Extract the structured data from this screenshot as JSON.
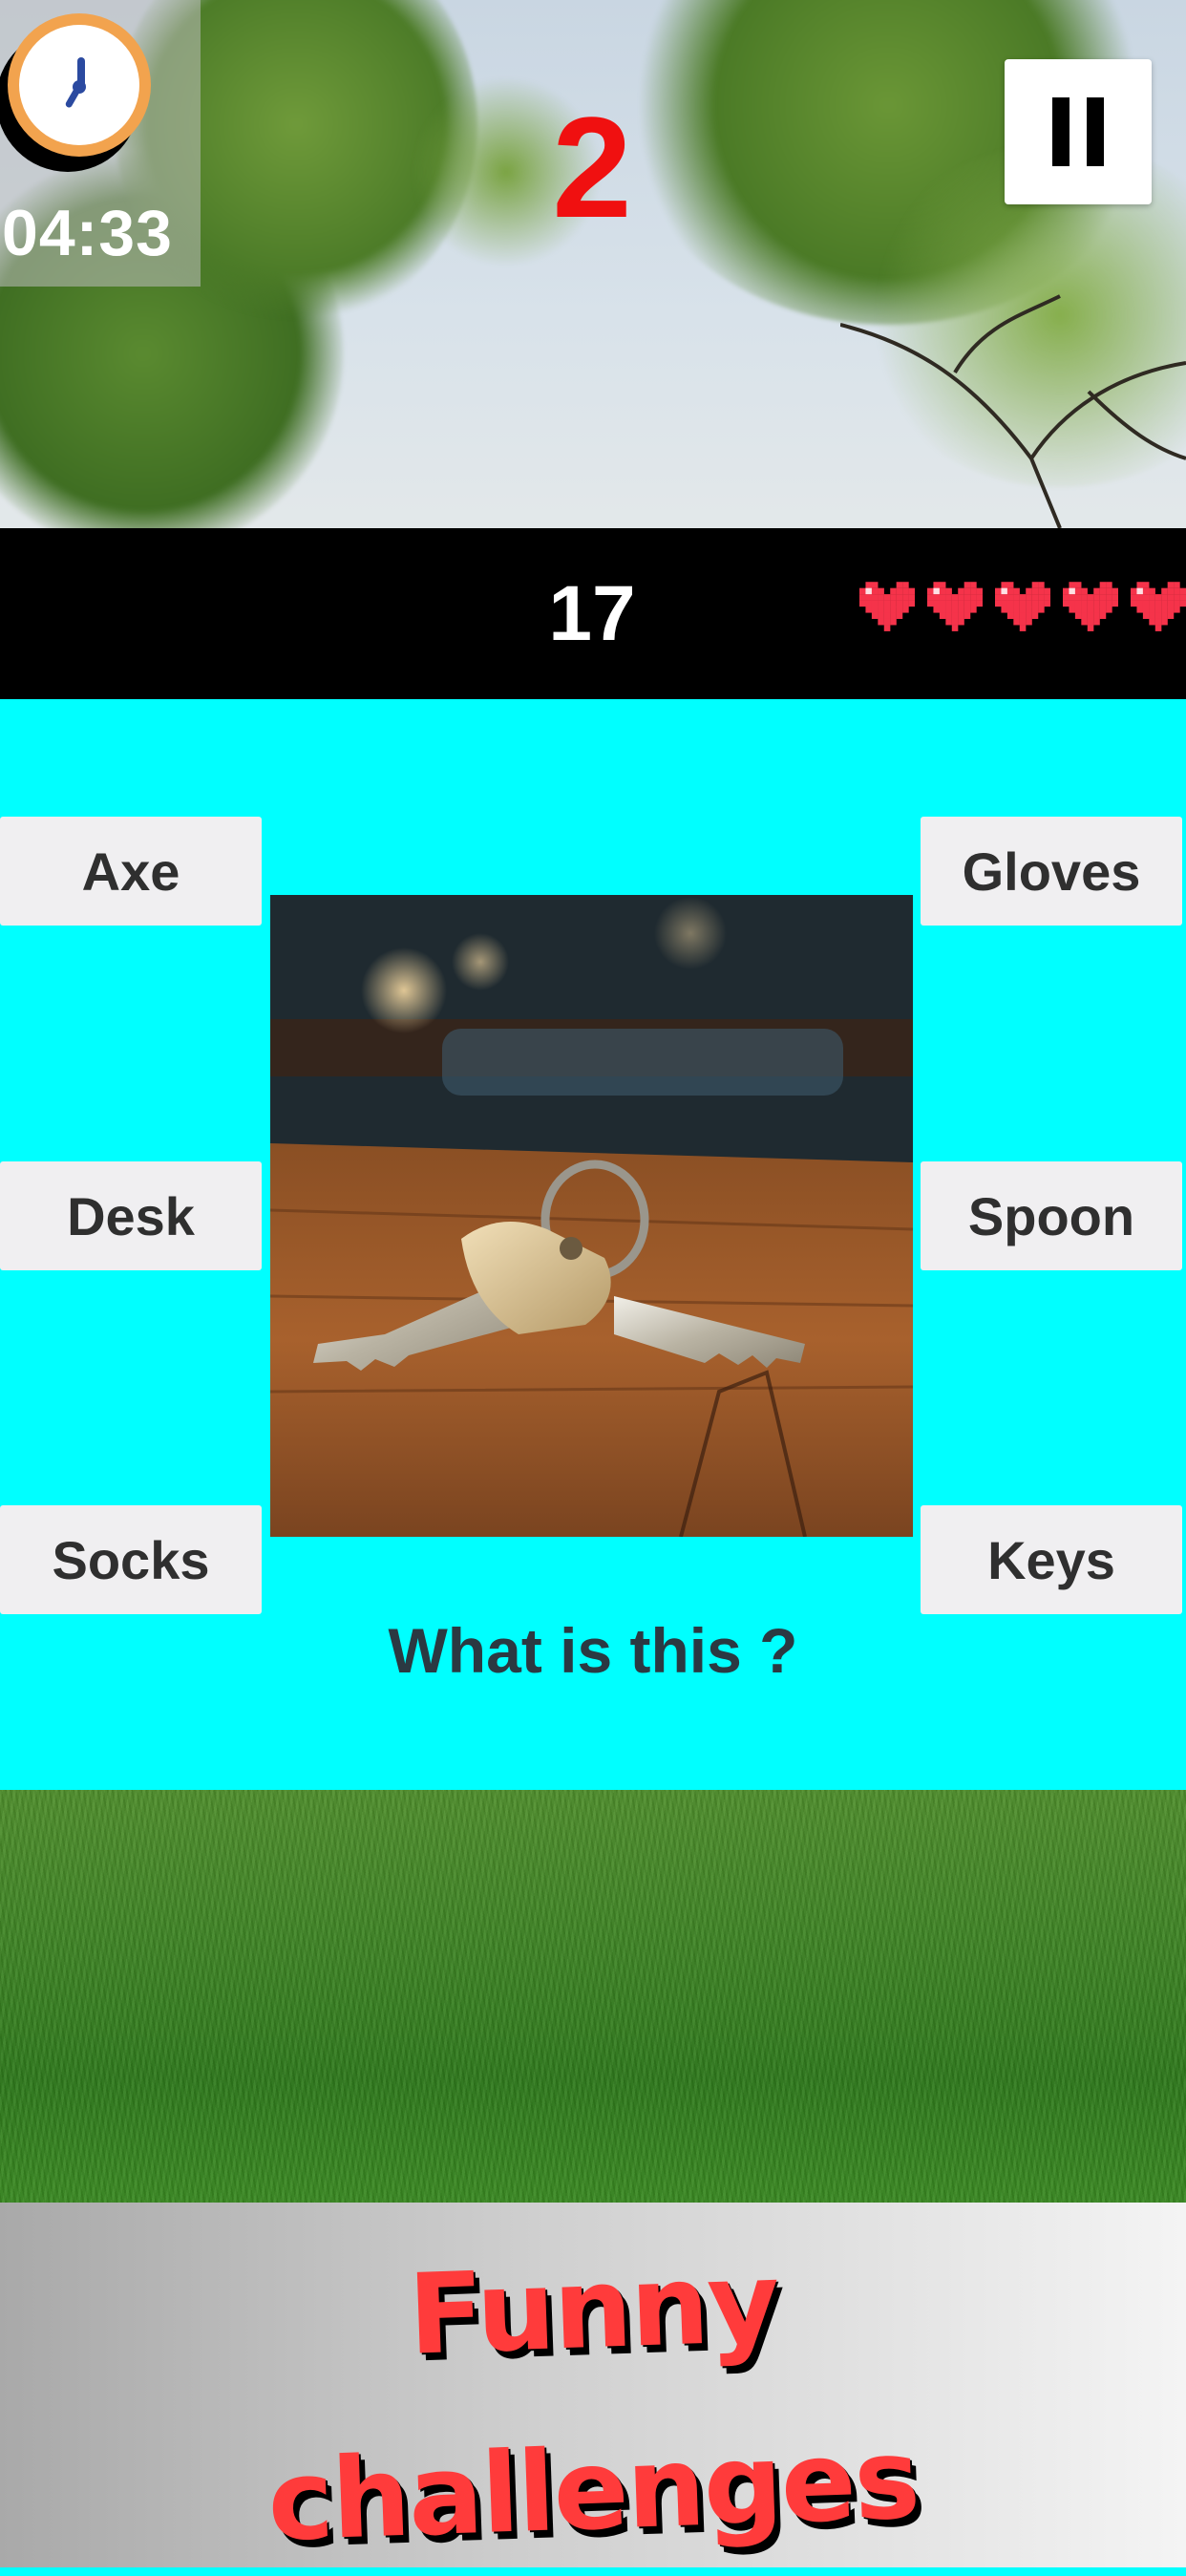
{
  "status": {
    "timer": "04:33",
    "round": "2",
    "score": "17",
    "lives": 5
  },
  "icons": {
    "clock": "clock-icon",
    "pause": "pause-icon",
    "life": "heart-icon"
  },
  "question": {
    "prompt": "What is this ?",
    "image": "keys-on-wooden-table"
  },
  "answers": {
    "left": [
      "Axe",
      "Desk",
      "Socks"
    ],
    "right": [
      "Gloves",
      "Spoon",
      "Keys"
    ]
  },
  "promo": {
    "line1": "Funny",
    "line2": "challenges"
  },
  "colors": {
    "quiz_background": "#00ffff",
    "round_number": "#f01010",
    "heart": "#f5334a",
    "promo_text": "#ff3b3b"
  }
}
